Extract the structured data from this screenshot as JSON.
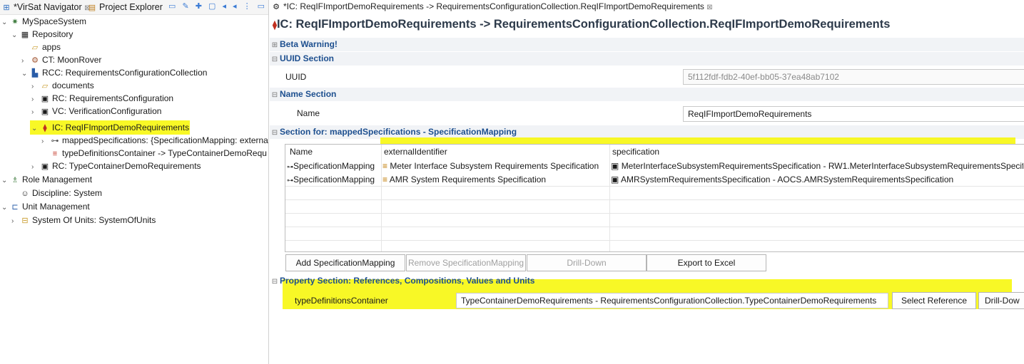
{
  "left": {
    "tabs": [
      {
        "label": "*VirSat Navigator"
      },
      {
        "label": "Project Explorer"
      }
    ],
    "tree": [
      {
        "label": "MySpaceSystem"
      },
      {
        "label": "Repository"
      },
      {
        "label": "apps"
      },
      {
        "label": "CT: MoonRover"
      },
      {
        "label": "RCC: RequirementsConfigurationCollection"
      },
      {
        "label": "documents"
      },
      {
        "label": "RC: RequirementsConfiguration"
      },
      {
        "label": "VC: VerificationConfiguration"
      },
      {
        "label": "IC: ReqIFImportDemoRequirements"
      },
      {
        "label": "mappedSpecifications: {SpecificationMapping: externa"
      },
      {
        "label": "typeDefinitionsContainer -> TypeContainerDemoRequ"
      },
      {
        "label": "RC: TypeContainerDemoRequirements"
      },
      {
        "label": "Role Management"
      },
      {
        "label": "Discipline: System"
      },
      {
        "label": "Unit Management"
      },
      {
        "label": "System Of Units: SystemOfUnits"
      }
    ]
  },
  "editor": {
    "tab_label": "*IC: ReqIFImportDemoRequirements -> RequirementsConfigurationCollection.ReqIFImportDemoRequirements",
    "title": "IC: ReqIFImportDemoRequirements -> RequirementsConfigurationCollection.ReqIFImportDemoRequirements",
    "beta_warning": "Beta Warning!",
    "uuid_section": "UUID Section",
    "uuid_label": "UUID",
    "uuid_value": "5f112fdf-fdb2-40ef-bb05-37ea48ab7102",
    "name_section": "Name Section",
    "name_label": "Name",
    "name_value": "ReqIFImportDemoRequirements",
    "mapping_section": "Section for: mappedSpecifications - SpecificationMapping",
    "table": {
      "columns": [
        "Name",
        "externalIdentifier",
        "specification"
      ],
      "rows": [
        {
          "name": "SpecificationMapping",
          "external": "Meter Interface Subsystem Requirements Specification",
          "spec": "MeterInterfaceSubsystemRequirementsSpecification - RW1.MeterInterfaceSubsystemRequirementsSpecifi..."
        },
        {
          "name": "SpecificationMapping",
          "external": "AMR System Requirements Specification",
          "spec": "AMRSystemRequirementsSpecification - AOCS.AMRSystemRequirementsSpecification"
        }
      ]
    },
    "buttons": {
      "add": "Add SpecificationMapping",
      "remove": "Remove SpecificationMapping",
      "drill": "Drill-Down",
      "export": "Export to Excel"
    },
    "property_section": "Property Section: References, Compositions, Values and Units",
    "ref_label": "typeDefinitionsContainer",
    "ref_value": "TypeContainerDemoRequirements - RequirementsConfigurationCollection.TypeContainerDemoRequirements",
    "select_ref": "Select Reference",
    "drill_ref": "Drill-Dow"
  },
  "colors": {
    "highlight": "#f7f700",
    "section_title": "#1d4f8f"
  },
  "icons": [
    "navigator-icon",
    "explorer-icon",
    "system-icon",
    "repository-icon",
    "folder-icon",
    "concept-icon",
    "collection-icon",
    "configuration-icon",
    "role-icon",
    "discipline-icon",
    "unit-icon",
    "mapping-icon",
    "requirement-icon",
    "spec-icon"
  ]
}
